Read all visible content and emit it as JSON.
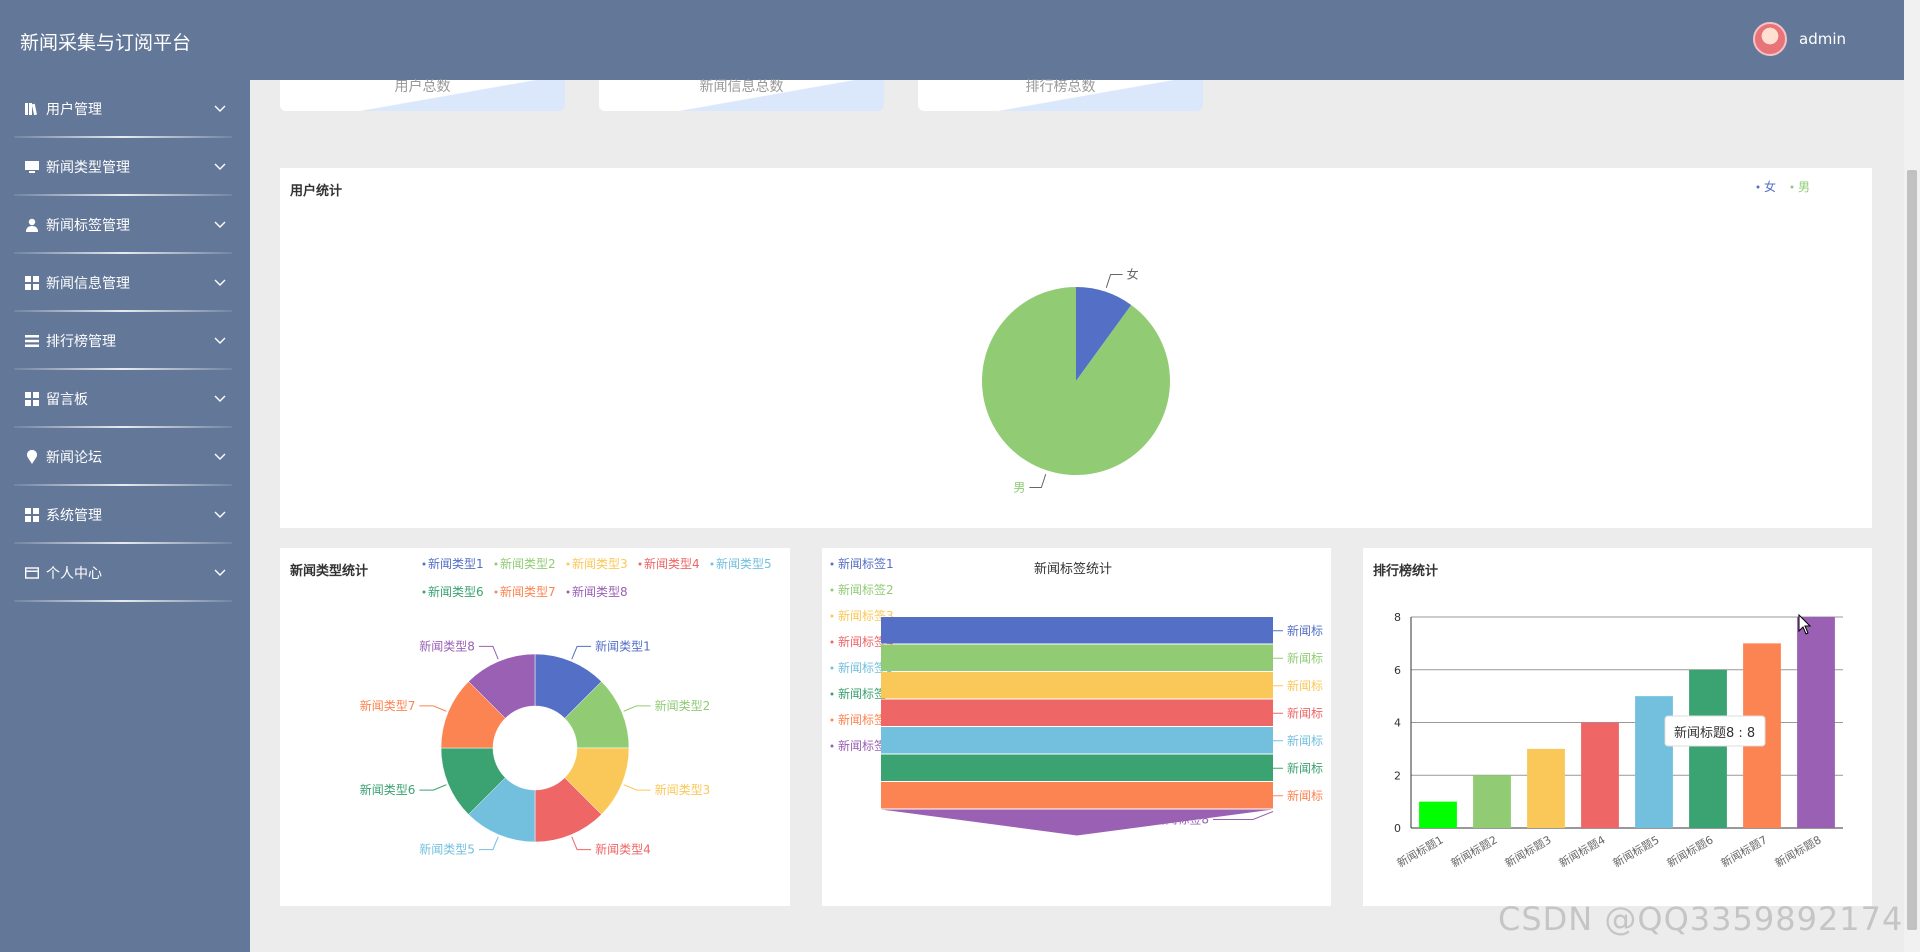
{
  "app": {
    "title": "新闻采集与订阅平台",
    "user": "admin"
  },
  "sidebar": {
    "items": [
      {
        "label": "用户管理",
        "icon": "library-icon"
      },
      {
        "label": "新闻类型管理",
        "icon": "monitor-icon"
      },
      {
        "label": "新闻标签管理",
        "icon": "user-icon"
      },
      {
        "label": "新闻信息管理",
        "icon": "grid-icon"
      },
      {
        "label": "排行榜管理",
        "icon": "list-icon"
      },
      {
        "label": "留言板",
        "icon": "grid-icon"
      },
      {
        "label": "新闻论坛",
        "icon": "location-pin-icon"
      },
      {
        "label": "系统管理",
        "icon": "grid-icon"
      },
      {
        "label": "个人中心",
        "icon": "card-icon"
      }
    ]
  },
  "stats": {
    "cards": [
      {
        "label": "用户总数"
      },
      {
        "label": "新闻信息总数"
      },
      {
        "label": "排行榜总数"
      }
    ]
  },
  "colors": {
    "header": "#637798",
    "palette": [
      "#5470c6",
      "#91cc75",
      "#fac858",
      "#ee6666",
      "#73c0de",
      "#3ba272",
      "#fc8452",
      "#9a60b4"
    ],
    "bar_colors": [
      "#00ff00",
      "#91cc75",
      "#fac858",
      "#ee6666",
      "#73c0de",
      "#3ba272",
      "#fc8452",
      "#9a60b4"
    ]
  },
  "user_chart": {
    "title": "用户统计",
    "chart_data": {
      "type": "pie",
      "labels": [
        "女",
        "男"
      ],
      "values": [
        1,
        9
      ],
      "legend_position": "top-right"
    }
  },
  "type_chart": {
    "title": "新闻类型统计",
    "chart_data": {
      "type": "pie",
      "labels": [
        "新闻类型1",
        "新闻类型2",
        "新闻类型3",
        "新闻类型4",
        "新闻类型5",
        "新闻类型6",
        "新闻类型7",
        "新闻类型8"
      ],
      "values": [
        1,
        1,
        1,
        1,
        1,
        1,
        1,
        1
      ],
      "legend_position": "top"
    }
  },
  "tag_chart": {
    "title": "新闻标签统计",
    "chart_data": {
      "type": "funnel",
      "labels": [
        "新闻标签1",
        "新闻标签2",
        "新闻标签3",
        "新闻标签4",
        "新闻标签5",
        "新闻标签6",
        "新闻标签7",
        "新闻标签8"
      ],
      "values": [
        1,
        1,
        1,
        1,
        1,
        1,
        1,
        1
      ],
      "side_labels": [
        "新闻标",
        "新闻标",
        "新闻标",
        "新闻标",
        "新闻标",
        "新闻标",
        "新闻标",
        "新闻标签8"
      ],
      "legend_position": "left"
    }
  },
  "rank_chart": {
    "title": "排行榜统计",
    "tooltip": "新闻标题8 : 8",
    "chart_data": {
      "type": "bar",
      "categories": [
        "新闻标题1",
        "新闻标题2",
        "新闻标题3",
        "新闻标题4",
        "新闻标题5",
        "新闻标题6",
        "新闻标题7",
        "新闻标题8"
      ],
      "values": [
        1,
        2,
        3,
        4,
        5,
        6,
        7,
        8
      ],
      "yticks": [
        "0",
        "2",
        "4",
        "6",
        "8"
      ],
      "ylim": [
        0,
        8
      ],
      "grid": true
    }
  },
  "watermark": "CSDN @QQ3359892174"
}
